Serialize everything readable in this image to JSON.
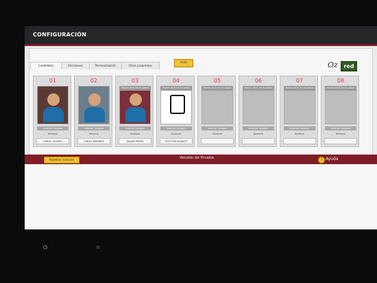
{
  "window": {
    "title": "CONFIGURACIÓN"
  },
  "tabs": [
    "Candidatos",
    "Elecciones",
    "Personalización",
    "Otros programas"
  ],
  "buttons": {
    "ok": "Hold",
    "reset": "Resetear votación",
    "help": "Ayuda"
  },
  "logo": {
    "left": "Oz",
    "right": "red"
  },
  "labels": {
    "version": "Versión de Prueba",
    "nombre": "Nombre",
    "insert": "Insertar imagen",
    "camera": "Hacer click en la placa"
  },
  "candidates": [
    {
      "number": "01",
      "name": "CAROL OSORIO",
      "image": true
    },
    {
      "number": "02",
      "name": "CAROL RAMIREZ",
      "image": true
    },
    {
      "number": "03",
      "name": "JULIAN PEREZ",
      "image": true
    },
    {
      "number": "04",
      "name": "VOTO EN BLANCO",
      "image": "blank"
    },
    {
      "number": "05",
      "name": "",
      "image": false
    },
    {
      "number": "06",
      "name": "",
      "image": false
    },
    {
      "number": "07",
      "name": "",
      "image": false
    },
    {
      "number": "08",
      "name": "",
      "image": false
    }
  ],
  "colors": {
    "accent": "#7f1d27",
    "button": "#f1c232",
    "number": "#e53935"
  }
}
